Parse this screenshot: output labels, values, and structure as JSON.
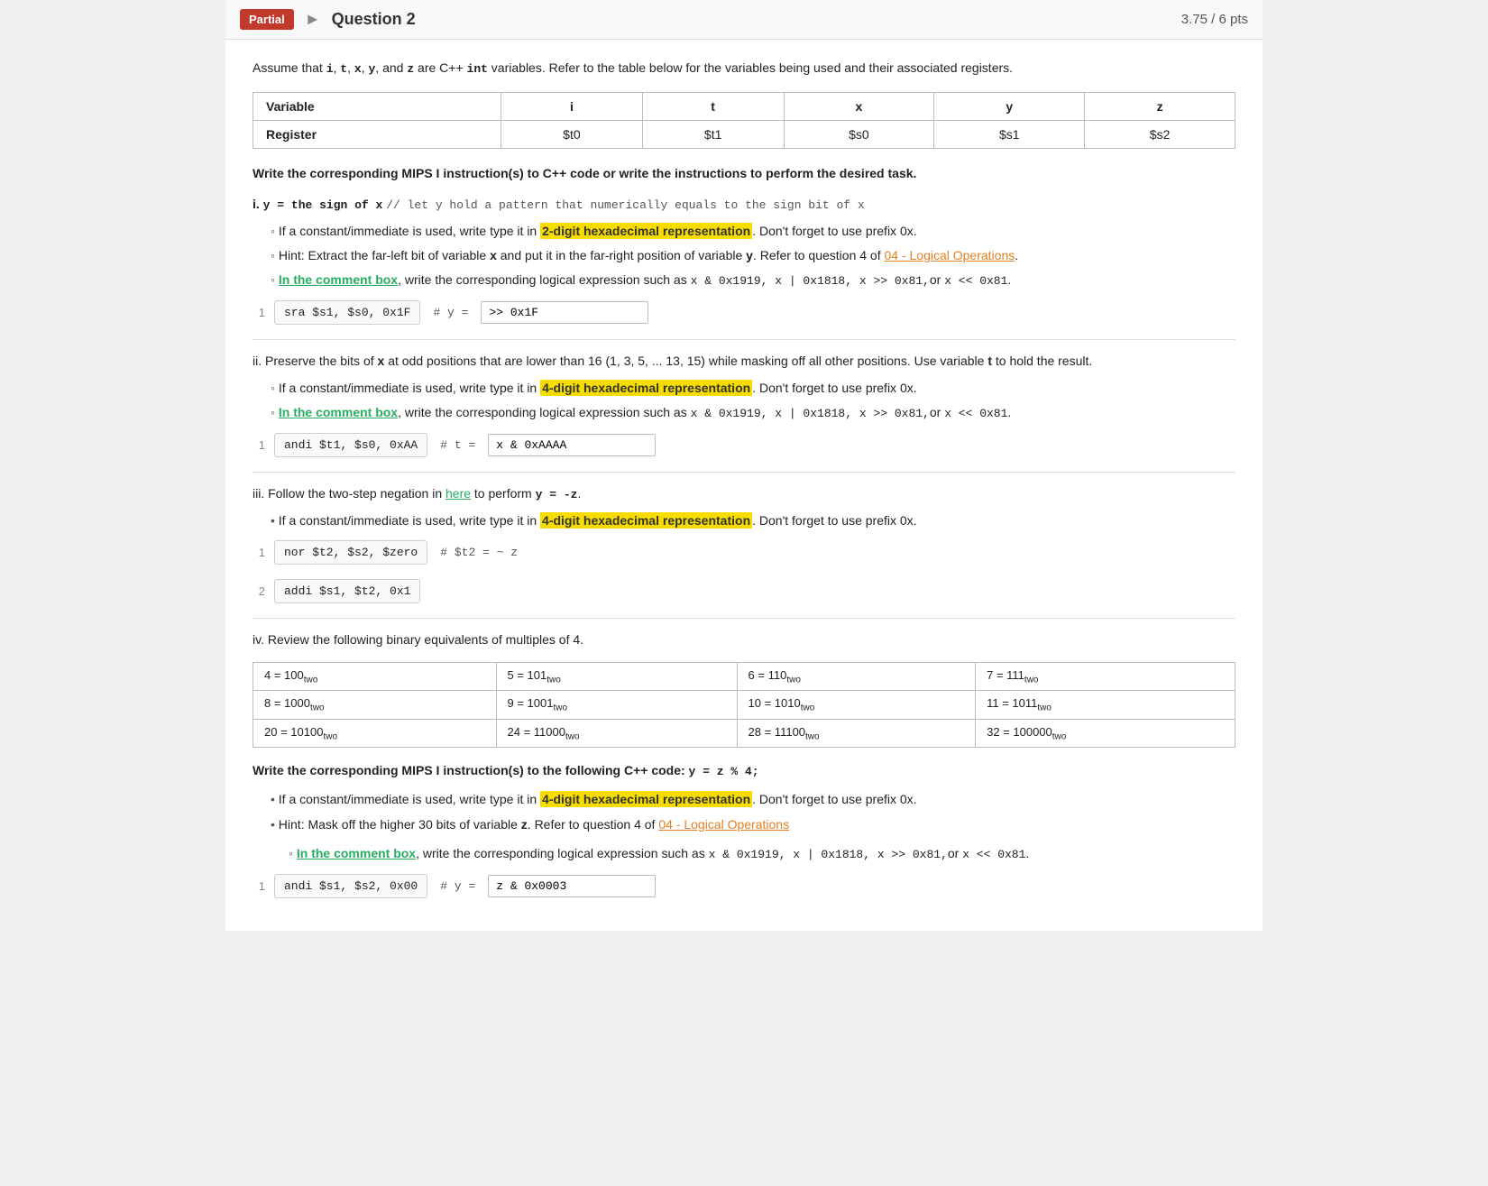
{
  "header": {
    "badge": "Partial",
    "title": "Question 2",
    "score": "3.75 / 6 pts"
  },
  "intro": {
    "text": "Assume that ",
    "vars": "i, t, x, y, and z",
    "text2": " are C++ ",
    "type": "int",
    "text3": " variables. Refer to the table below for the variables being used and their associated registers."
  },
  "variable_table": {
    "headers": [
      "Variable",
      "i",
      "t",
      "x",
      "y",
      "z"
    ],
    "rows": [
      [
        "Register",
        "$t0",
        "$t1",
        "$s0",
        "$s1",
        "$s2"
      ]
    ]
  },
  "write_instruction": "Write the corresponding MIPS I instruction(s) to C++ code or write the instructions to perform the desired task.",
  "part_i": {
    "label": "i. y = the sign of x",
    "comment": "// let y hold a pattern that numerically equals to the sign bit of x",
    "bullets": [
      "If a constant/immediate is used, write type it in 2-digit hexadecimal representation. Don't forget to use prefix 0x.",
      "Hint: Extract the far-left bit of variable x and put it in the far-right position of variable y. Refer to question 4 of 04 - Logical Operations.",
      "In the comment box, write the corresponding logical expression such as x & 0x1919, x | 0x1818, x >> 0x81, or x << 0x81."
    ],
    "highlight_bullet": "2-digit hexadecimal representation",
    "green_bullet": "In the comment box",
    "link_text": "04 - Logical Operations",
    "code_lines": [
      {
        "num": "1",
        "instruction": "sra $s1, $s0, 0x1F",
        "hash": "#",
        "comment_label": "y =",
        "comment_value": ">> 0x1F"
      }
    ]
  },
  "part_ii": {
    "label": "ii. Preserve the bits of x at odd positions that are lower than 16 (1, 3, 5, ... 13, 15) while masking off all other positions. Use variable t to hold the result.",
    "bullets": [
      "If a constant/immediate is used, write type it in 4-digit hexadecimal representation. Don't forget to use prefix 0x.",
      "In the comment box, write the corresponding logical expression such as x & 0x1919, x | 0x1818, x >> 0x81, or x << 0x81."
    ],
    "highlight_bullet": "4-digit hexadecimal representation",
    "green_bullet": "In the comment box",
    "code_lines": [
      {
        "num": "1",
        "instruction": "andi $t1, $s0, 0xAA",
        "hash": "#",
        "comment_label": "t =",
        "comment_value": "x & 0xAAAA"
      }
    ]
  },
  "part_iii": {
    "label": "iii. Follow the two-step negation in here to perform y = -z.",
    "link_text": "here",
    "bullets": [
      "If a constant/immediate is used, write type it in 4-digit hexadecimal representation. Don't forget to use prefix 0x."
    ],
    "highlight_bullet": "4-digit hexadecimal representation",
    "code_lines": [
      {
        "num": "1",
        "instruction": "nor $t2, $s2, $zero",
        "hash": "#",
        "comment_label": "$t2 = ~",
        "comment_value": "z"
      },
      {
        "num": "2",
        "instruction": "addi $s1, $t2, 0x1",
        "hash": "",
        "comment_label": "",
        "comment_value": ""
      }
    ]
  },
  "part_iv": {
    "label": "iv. Review the following binary equivalents of multiples of 4.",
    "binary_table": [
      [
        "4 = 100",
        "two",
        "5 = 101",
        "two",
        "6 = 110",
        "two",
        "7 = 111",
        "two"
      ],
      [
        "8 = 1000",
        "two",
        "9 = 1001",
        "two",
        "10 = 1010",
        "two",
        "11 = 1011",
        "two"
      ],
      [
        "20 = 10100",
        "two",
        "24 = 11000",
        "two",
        "28 = 11100",
        "two",
        "32 = 100000",
        "two"
      ]
    ],
    "write_instruction": "Write the corresponding MIPS I instruction(s) to the following C++ code: y = z % 4;",
    "bullets": [
      "If a constant/immediate is used, write type it in 4-digit hexadecimal representation. Don't forget to use prefix 0x.",
      "Hint: Mask off the higher 30 bits of variable z. Refer to question 4 of 04 - Logical Operations",
      "In the comment box, write the corresponding logical expression such as x & 0x1919, x | 0x1818, x >> 0x81, or x << 0x81."
    ],
    "highlight_bullet1": "4-digit hexadecimal representation",
    "green_bullet": "In the comment box",
    "link_text": "04 - Logical Operations",
    "code_lines": [
      {
        "num": "1",
        "instruction": "andi $s1, $s2, 0x00",
        "hash": "#",
        "comment_label": "y =",
        "comment_value": "z & 0x0003"
      }
    ]
  }
}
